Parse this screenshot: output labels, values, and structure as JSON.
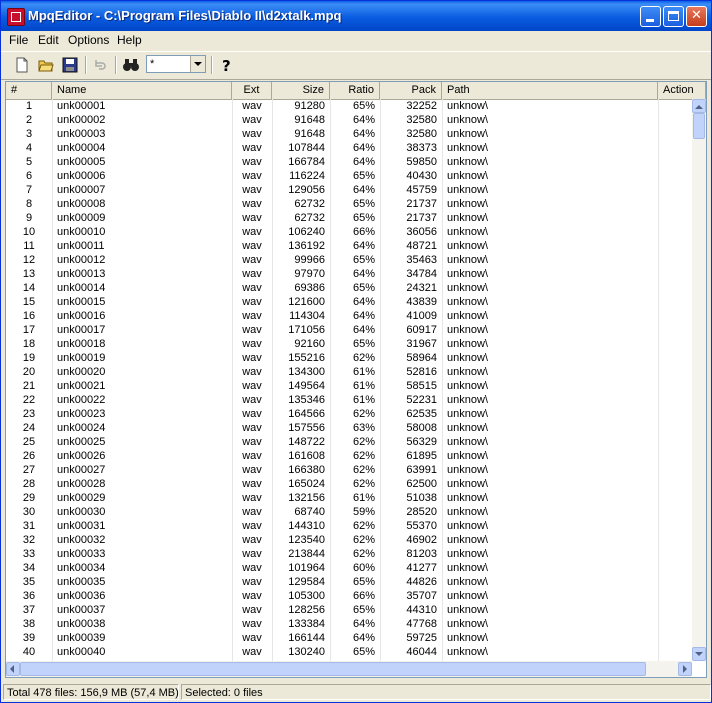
{
  "window": {
    "title": "MpqEditor - C:\\Program Files\\Diablo II\\d2xtalk.mpq"
  },
  "menu": [
    "File",
    "Edit",
    "Options",
    "Help"
  ],
  "toolbar": {
    "filter_value": "*",
    "icons": [
      "new-file-icon",
      "open-folder-icon",
      "save-disk-icon",
      "undo-icon",
      "find-binoculars-icon",
      "help-question-icon"
    ]
  },
  "list": {
    "columns": {
      "num": "#",
      "name": "Name",
      "ext": "Ext",
      "size": "Size",
      "ratio": "Ratio",
      "pack": "Pack",
      "path": "Path",
      "action": "Action"
    },
    "rows": [
      {
        "num": "1",
        "name": "unk00001",
        "ext": "wav",
        "size": "91280",
        "ratio": "65%",
        "pack": "32252",
        "path": "unknow\\"
      },
      {
        "num": "2",
        "name": "unk00002",
        "ext": "wav",
        "size": "91648",
        "ratio": "64%",
        "pack": "32580",
        "path": "unknow\\"
      },
      {
        "num": "3",
        "name": "unk00003",
        "ext": "wav",
        "size": "91648",
        "ratio": "64%",
        "pack": "32580",
        "path": "unknow\\"
      },
      {
        "num": "4",
        "name": "unk00004",
        "ext": "wav",
        "size": "107844",
        "ratio": "64%",
        "pack": "38373",
        "path": "unknow\\"
      },
      {
        "num": "5",
        "name": "unk00005",
        "ext": "wav",
        "size": "166784",
        "ratio": "64%",
        "pack": "59850",
        "path": "unknow\\"
      },
      {
        "num": "6",
        "name": "unk00006",
        "ext": "wav",
        "size": "116224",
        "ratio": "65%",
        "pack": "40430",
        "path": "unknow\\"
      },
      {
        "num": "7",
        "name": "unk00007",
        "ext": "wav",
        "size": "129056",
        "ratio": "64%",
        "pack": "45759",
        "path": "unknow\\"
      },
      {
        "num": "8",
        "name": "unk00008",
        "ext": "wav",
        "size": "62732",
        "ratio": "65%",
        "pack": "21737",
        "path": "unknow\\"
      },
      {
        "num": "9",
        "name": "unk00009",
        "ext": "wav",
        "size": "62732",
        "ratio": "65%",
        "pack": "21737",
        "path": "unknow\\"
      },
      {
        "num": "10",
        "name": "unk00010",
        "ext": "wav",
        "size": "106240",
        "ratio": "66%",
        "pack": "36056",
        "path": "unknow\\"
      },
      {
        "num": "11",
        "name": "unk00011",
        "ext": "wav",
        "size": "136192",
        "ratio": "64%",
        "pack": "48721",
        "path": "unknow\\"
      },
      {
        "num": "12",
        "name": "unk00012",
        "ext": "wav",
        "size": "99966",
        "ratio": "65%",
        "pack": "35463",
        "path": "unknow\\"
      },
      {
        "num": "13",
        "name": "unk00013",
        "ext": "wav",
        "size": "97970",
        "ratio": "64%",
        "pack": "34784",
        "path": "unknow\\"
      },
      {
        "num": "14",
        "name": "unk00014",
        "ext": "wav",
        "size": "69386",
        "ratio": "65%",
        "pack": "24321",
        "path": "unknow\\"
      },
      {
        "num": "15",
        "name": "unk00015",
        "ext": "wav",
        "size": "121600",
        "ratio": "64%",
        "pack": "43839",
        "path": "unknow\\"
      },
      {
        "num": "16",
        "name": "unk00016",
        "ext": "wav",
        "size": "114304",
        "ratio": "64%",
        "pack": "41009",
        "path": "unknow\\"
      },
      {
        "num": "17",
        "name": "unk00017",
        "ext": "wav",
        "size": "171056",
        "ratio": "64%",
        "pack": "60917",
        "path": "unknow\\"
      },
      {
        "num": "18",
        "name": "unk00018",
        "ext": "wav",
        "size": "92160",
        "ratio": "65%",
        "pack": "31967",
        "path": "unknow\\"
      },
      {
        "num": "19",
        "name": "unk00019",
        "ext": "wav",
        "size": "155216",
        "ratio": "62%",
        "pack": "58964",
        "path": "unknow\\"
      },
      {
        "num": "20",
        "name": "unk00020",
        "ext": "wav",
        "size": "134300",
        "ratio": "61%",
        "pack": "52816",
        "path": "unknow\\"
      },
      {
        "num": "21",
        "name": "unk00021",
        "ext": "wav",
        "size": "149564",
        "ratio": "61%",
        "pack": "58515",
        "path": "unknow\\"
      },
      {
        "num": "22",
        "name": "unk00022",
        "ext": "wav",
        "size": "135346",
        "ratio": "61%",
        "pack": "52231",
        "path": "unknow\\"
      },
      {
        "num": "23",
        "name": "unk00023",
        "ext": "wav",
        "size": "164566",
        "ratio": "62%",
        "pack": "62535",
        "path": "unknow\\"
      },
      {
        "num": "24",
        "name": "unk00024",
        "ext": "wav",
        "size": "157556",
        "ratio": "63%",
        "pack": "58008",
        "path": "unknow\\"
      },
      {
        "num": "25",
        "name": "unk00025",
        "ext": "wav",
        "size": "148722",
        "ratio": "62%",
        "pack": "56329",
        "path": "unknow\\"
      },
      {
        "num": "26",
        "name": "unk00026",
        "ext": "wav",
        "size": "161608",
        "ratio": "62%",
        "pack": "61895",
        "path": "unknow\\"
      },
      {
        "num": "27",
        "name": "unk00027",
        "ext": "wav",
        "size": "166380",
        "ratio": "62%",
        "pack": "63991",
        "path": "unknow\\"
      },
      {
        "num": "28",
        "name": "unk00028",
        "ext": "wav",
        "size": "165024",
        "ratio": "62%",
        "pack": "62500",
        "path": "unknow\\"
      },
      {
        "num": "29",
        "name": "unk00029",
        "ext": "wav",
        "size": "132156",
        "ratio": "61%",
        "pack": "51038",
        "path": "unknow\\"
      },
      {
        "num": "30",
        "name": "unk00030",
        "ext": "wav",
        "size": "68740",
        "ratio": "59%",
        "pack": "28520",
        "path": "unknow\\"
      },
      {
        "num": "31",
        "name": "unk00031",
        "ext": "wav",
        "size": "144310",
        "ratio": "62%",
        "pack": "55370",
        "path": "unknow\\"
      },
      {
        "num": "32",
        "name": "unk00032",
        "ext": "wav",
        "size": "123540",
        "ratio": "62%",
        "pack": "46902",
        "path": "unknow\\"
      },
      {
        "num": "33",
        "name": "unk00033",
        "ext": "wav",
        "size": "213844",
        "ratio": "62%",
        "pack": "81203",
        "path": "unknow\\"
      },
      {
        "num": "34",
        "name": "unk00034",
        "ext": "wav",
        "size": "101964",
        "ratio": "60%",
        "pack": "41277",
        "path": "unknow\\"
      },
      {
        "num": "35",
        "name": "unk00035",
        "ext": "wav",
        "size": "129584",
        "ratio": "65%",
        "pack": "44826",
        "path": "unknow\\"
      },
      {
        "num": "36",
        "name": "unk00036",
        "ext": "wav",
        "size": "105300",
        "ratio": "66%",
        "pack": "35707",
        "path": "unknow\\"
      },
      {
        "num": "37",
        "name": "unk00037",
        "ext": "wav",
        "size": "128256",
        "ratio": "65%",
        "pack": "44310",
        "path": "unknow\\"
      },
      {
        "num": "38",
        "name": "unk00038",
        "ext": "wav",
        "size": "133384",
        "ratio": "64%",
        "pack": "47768",
        "path": "unknow\\"
      },
      {
        "num": "39",
        "name": "unk00039",
        "ext": "wav",
        "size": "166144",
        "ratio": "64%",
        "pack": "59725",
        "path": "unknow\\"
      },
      {
        "num": "40",
        "name": "unk00040",
        "ext": "wav",
        "size": "130240",
        "ratio": "65%",
        "pack": "46044",
        "path": "unknow\\"
      }
    ]
  },
  "status": {
    "total": "Total 478 files: 156,9 MB (57,4 MB)",
    "selected": "Selected: 0 files"
  }
}
